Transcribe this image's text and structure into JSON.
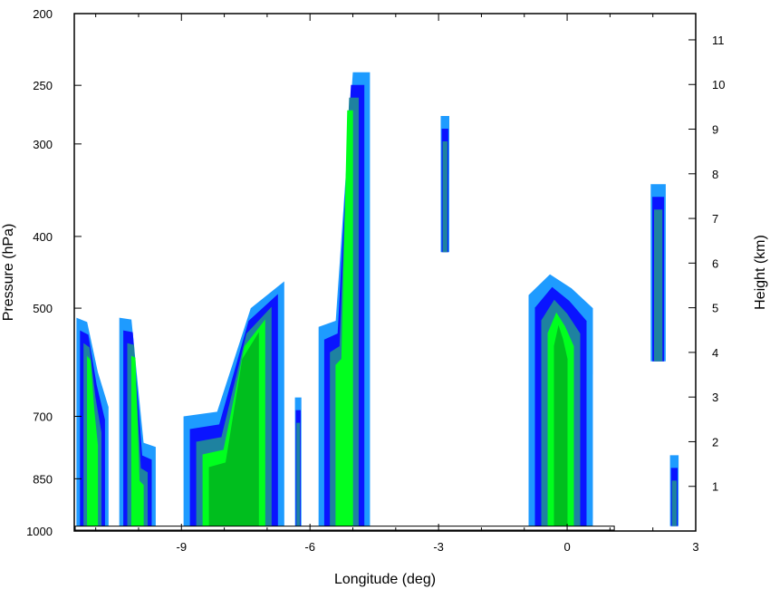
{
  "chart_data": {
    "type": "heatmap",
    "title": "",
    "xlabel": "Longitude (deg)",
    "ylabel_left": "Pressure (hPa)",
    "ylabel_right": "Height (km)",
    "x_range": [
      -11.5,
      3
    ],
    "x_ticks": [
      -9,
      -6,
      -3,
      0,
      3
    ],
    "x_tick_labels": [
      "-9",
      "-6",
      "-3",
      "0",
      "3"
    ],
    "pressure_range": [
      200,
      1000
    ],
    "pressure_ticks": [
      200,
      250,
      300,
      400,
      500,
      700,
      850,
      1000
    ],
    "pressure_tick_labels": [
      "200",
      "250",
      "300",
      "400",
      "500",
      "700",
      "850",
      "1000"
    ],
    "height_ticks": [
      1,
      2,
      3,
      4,
      5,
      6,
      7,
      8,
      9,
      10,
      11
    ],
    "height_tick_labels": [
      "1",
      "2",
      "3",
      "4",
      "5",
      "6",
      "7",
      "8",
      "9",
      "10",
      "11"
    ],
    "contour_levels_colors": [
      "#1E9BFF",
      "#0A14FF",
      "#1E82A0",
      "#00FF1E",
      "#00BE1E",
      "#FFD200"
    ],
    "cells": [
      {
        "x": [
          -11.45,
          -10.7
        ],
        "p_top": [
          515,
          522,
          610,
          680
        ],
        "p_bottom": 985,
        "level": 1
      },
      {
        "x": [
          -10.45,
          -9.6
        ],
        "p_top": [
          515,
          518,
          760,
          770
        ],
        "p_bottom": 985,
        "level": 1
      },
      {
        "x": [
          -8.95,
          -6.6
        ],
        "p_top": [
          700,
          690,
          500,
          460
        ],
        "p_bottom": 985,
        "level": 1
      },
      {
        "x": [
          -6.35,
          -6.2
        ],
        "p_top": [
          660,
          660
        ],
        "p_bottom": 985,
        "level": 1
      },
      {
        "x": [
          -5.8,
          -4.6
        ],
        "p_top": [
          530,
          520,
          240,
          240
        ],
        "p_bottom": 985,
        "level": 1
      },
      {
        "x": [
          -2.95,
          -2.75
        ],
        "p_top": [
          275,
          275
        ],
        "p_bottom": 420,
        "level": 1
      },
      {
        "x": [
          -0.9,
          0.6
        ],
        "p_top": [
          480,
          450,
          470,
          500
        ],
        "p_bottom": 985,
        "level": 1
      },
      {
        "x": [
          1.95,
          2.3
        ],
        "p_top": [
          340,
          340
        ],
        "p_bottom": 590,
        "level": 1
      },
      {
        "x": [
          2.4,
          2.6
        ],
        "p_top": [
          790,
          790
        ],
        "p_bottom": 985,
        "level": 1
      }
    ],
    "terrain_pressure_top": 985,
    "grid": false,
    "legend": "none"
  }
}
